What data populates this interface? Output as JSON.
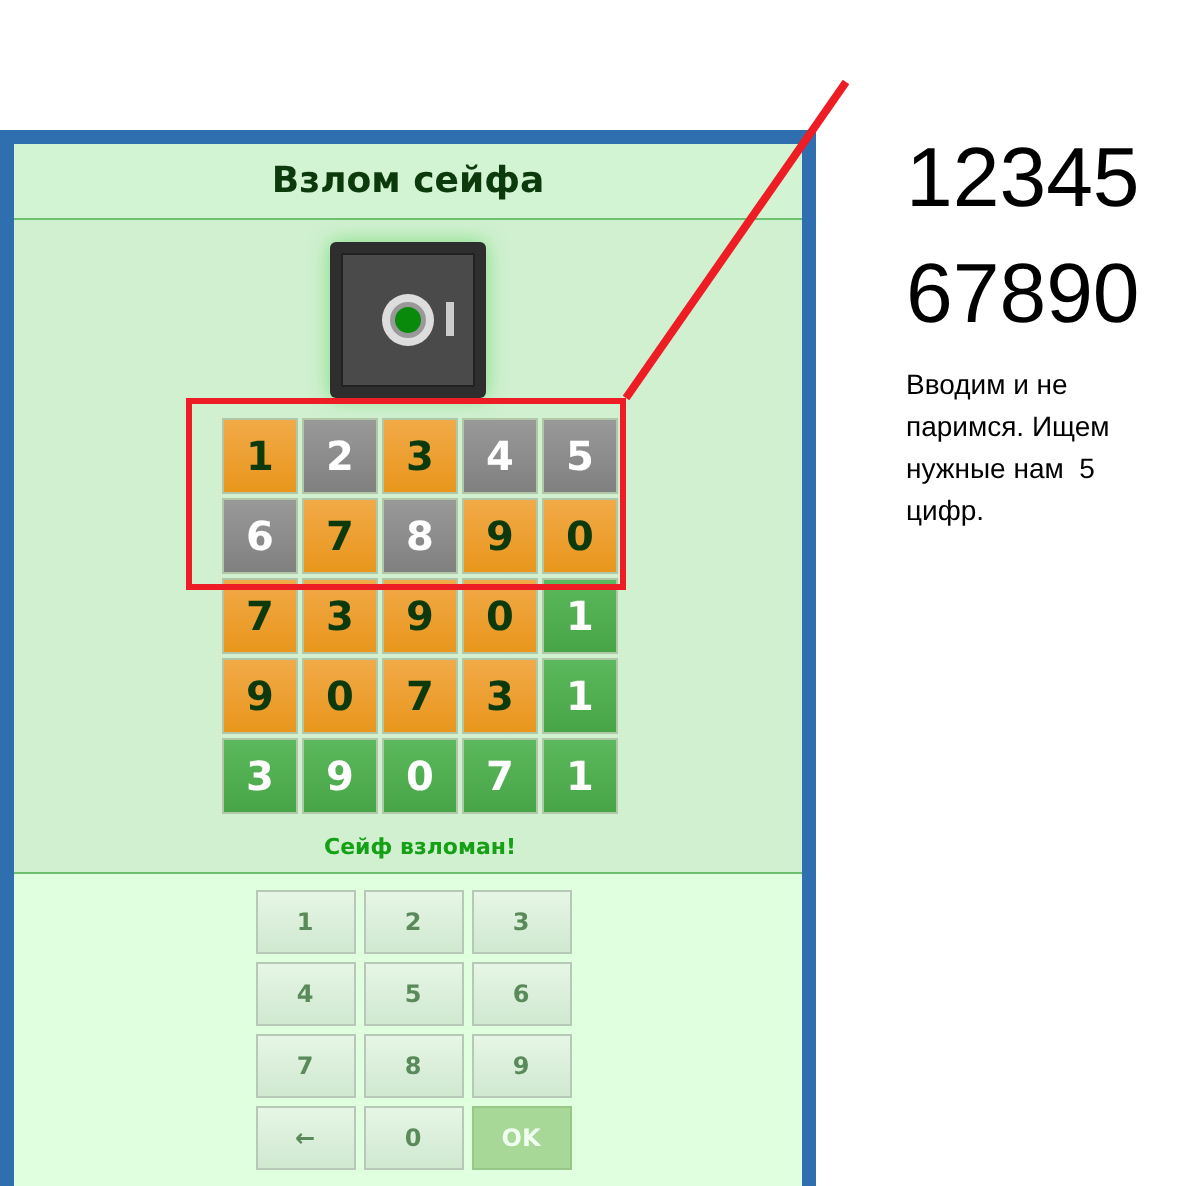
{
  "game": {
    "title": "Взлом сейфа",
    "safe": {
      "unlocked": true
    },
    "guesses": [
      {
        "cells": [
          {
            "digit": "1",
            "kind": "misplaced"
          },
          {
            "digit": "2",
            "kind": "absent"
          },
          {
            "digit": "3",
            "kind": "misplaced"
          },
          {
            "digit": "4",
            "kind": "absent"
          },
          {
            "digit": "5",
            "kind": "absent"
          }
        ]
      },
      {
        "cells": [
          {
            "digit": "6",
            "kind": "absent"
          },
          {
            "digit": "7",
            "kind": "misplaced"
          },
          {
            "digit": "8",
            "kind": "absent"
          },
          {
            "digit": "9",
            "kind": "misplaced"
          },
          {
            "digit": "0",
            "kind": "misplaced"
          }
        ]
      },
      {
        "cells": [
          {
            "digit": "7",
            "kind": "misplaced"
          },
          {
            "digit": "3",
            "kind": "misplaced"
          },
          {
            "digit": "9",
            "kind": "misplaced"
          },
          {
            "digit": "0",
            "kind": "misplaced"
          },
          {
            "digit": "1",
            "kind": "correct"
          }
        ]
      },
      {
        "cells": [
          {
            "digit": "9",
            "kind": "misplaced"
          },
          {
            "digit": "0",
            "kind": "misplaced"
          },
          {
            "digit": "7",
            "kind": "misplaced"
          },
          {
            "digit": "3",
            "kind": "misplaced"
          },
          {
            "digit": "1",
            "kind": "correct"
          }
        ]
      },
      {
        "cells": [
          {
            "digit": "3",
            "kind": "correct"
          },
          {
            "digit": "9",
            "kind": "correct"
          },
          {
            "digit": "0",
            "kind": "correct"
          },
          {
            "digit": "7",
            "kind": "correct"
          },
          {
            "digit": "1",
            "kind": "correct"
          }
        ]
      }
    ],
    "status": "Сейф взломан!",
    "keypad": [
      {
        "label": "1",
        "kind": "digit"
      },
      {
        "label": "2",
        "kind": "digit"
      },
      {
        "label": "3",
        "kind": "digit"
      },
      {
        "label": "4",
        "kind": "digit"
      },
      {
        "label": "5",
        "kind": "digit"
      },
      {
        "label": "6",
        "kind": "digit"
      },
      {
        "label": "7",
        "kind": "digit"
      },
      {
        "label": "8",
        "kind": "digit"
      },
      {
        "label": "9",
        "kind": "digit"
      },
      {
        "label": "←",
        "kind": "backspace"
      },
      {
        "label": "0",
        "kind": "digit"
      },
      {
        "label": "OK",
        "kind": "submit"
      }
    ]
  },
  "notes": {
    "lines": [
      "12345",
      "67890"
    ],
    "text": "Вводим и не паримся. Ищем нужные нам  5 цифр."
  }
}
